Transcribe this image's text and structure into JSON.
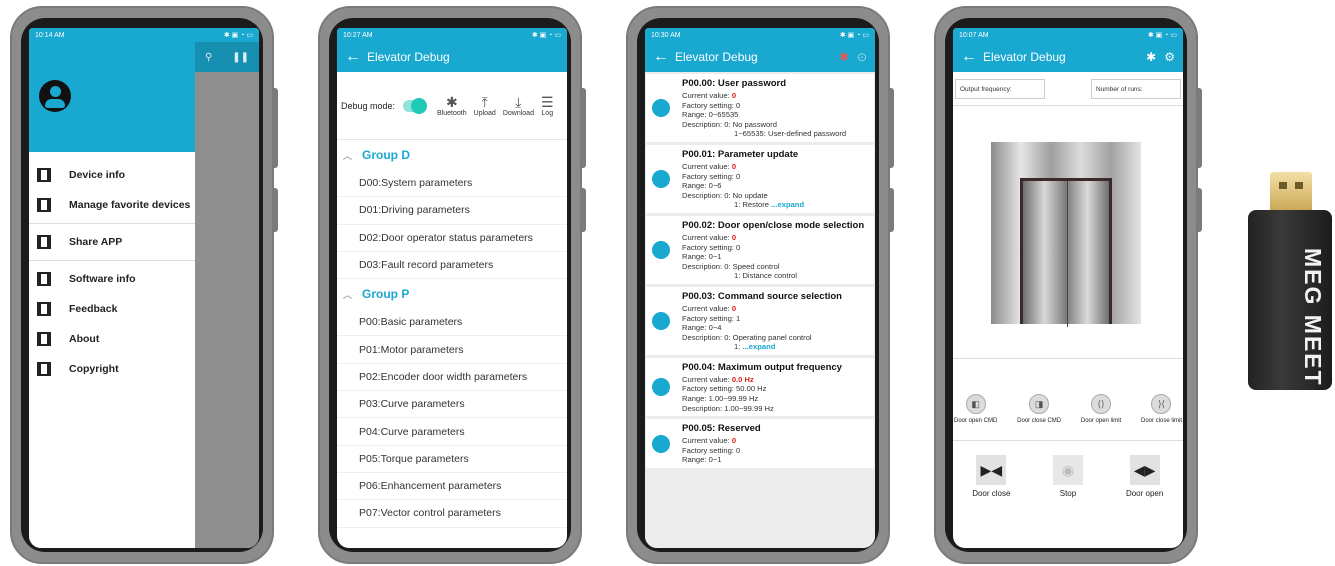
{
  "phone1": {
    "status_time": "10:14 AM",
    "menu": [
      {
        "label": "Device info"
      },
      {
        "label": "Manage favorite devices"
      },
      {
        "label": "Share APP"
      },
      {
        "label": "Software info"
      },
      {
        "label": "Feedback"
      },
      {
        "label": "About"
      },
      {
        "label": "Copyright"
      }
    ]
  },
  "phone2": {
    "status_time": "10:27 AM",
    "title": "Elevator Debug",
    "debug_mode_label": "Debug mode:",
    "tools": {
      "bluetooth": "Bluetooth",
      "upload": "Upload",
      "download": "Download",
      "log": "Log"
    },
    "groups": [
      {
        "name": "Group D",
        "items": [
          "D00:System parameters",
          "D01:Driving parameters",
          "D02:Door operator status parameters",
          "D03:Fault record parameters"
        ]
      },
      {
        "name": "Group P",
        "items": [
          "P00:Basic parameters",
          "P01:Motor parameters",
          "P02:Encoder door width parameters",
          "P03:Curve parameters",
          "P04:Curve parameters",
          "P05:Torque parameters",
          "P06:Enhancement parameters",
          "P07:Vector control parameters"
        ]
      }
    ]
  },
  "phone3": {
    "status_time": "10:30 AM",
    "title": "Elevator Debug",
    "labels": {
      "current": "Current value:",
      "factory": "Factory setting:",
      "range": "Range:",
      "description": "Description:"
    },
    "params": [
      {
        "title": "P00.00: User password",
        "current": "0",
        "factory": "0",
        "range": "0~65535",
        "desc": "0: No password",
        "desc2": "1~65535: User-defined password",
        "expand": ""
      },
      {
        "title": "P00.01: Parameter update",
        "current": "0",
        "factory": "0",
        "range": "0~6",
        "desc": "0: No update",
        "desc2": "1: Restore",
        "expand": "...expand"
      },
      {
        "title": "P00.02: Door open/close mode selection",
        "current": "0",
        "factory": "0",
        "range": "0~1",
        "desc": "0: Speed control",
        "desc2": "1: Distance control",
        "expand": ""
      },
      {
        "title": "P00.03: Command source selection",
        "current": "0",
        "factory": "1",
        "range": "0~4",
        "desc": "0: Operating panel control",
        "desc2": "1:",
        "expand": "...expand"
      },
      {
        "title": "P00.04: Maximum output frequency",
        "current": "0.0 Hz",
        "factory": "50.00 Hz",
        "range": "1.00~99.99 Hz",
        "desc": "1.00~99.99 Hz",
        "desc2": "",
        "expand": ""
      },
      {
        "title": "P00.05: Reserved",
        "current": "0",
        "factory": "0",
        "range": "0~1",
        "desc": "",
        "desc2": "",
        "expand": ""
      }
    ]
  },
  "phone4": {
    "status_time": "10:07 AM",
    "title": "Elevator Debug",
    "output_frequency_label": "Output frequency:",
    "number_of_runs_label": "Number of runs:",
    "limits": [
      "Door open CMD",
      "Door close CMD",
      "Door open limit",
      "Door close limit"
    ],
    "actions": {
      "close": "Door close",
      "stop": "Stop",
      "open": "Door open"
    }
  },
  "dongle": {
    "brand": "MEG MEET"
  }
}
